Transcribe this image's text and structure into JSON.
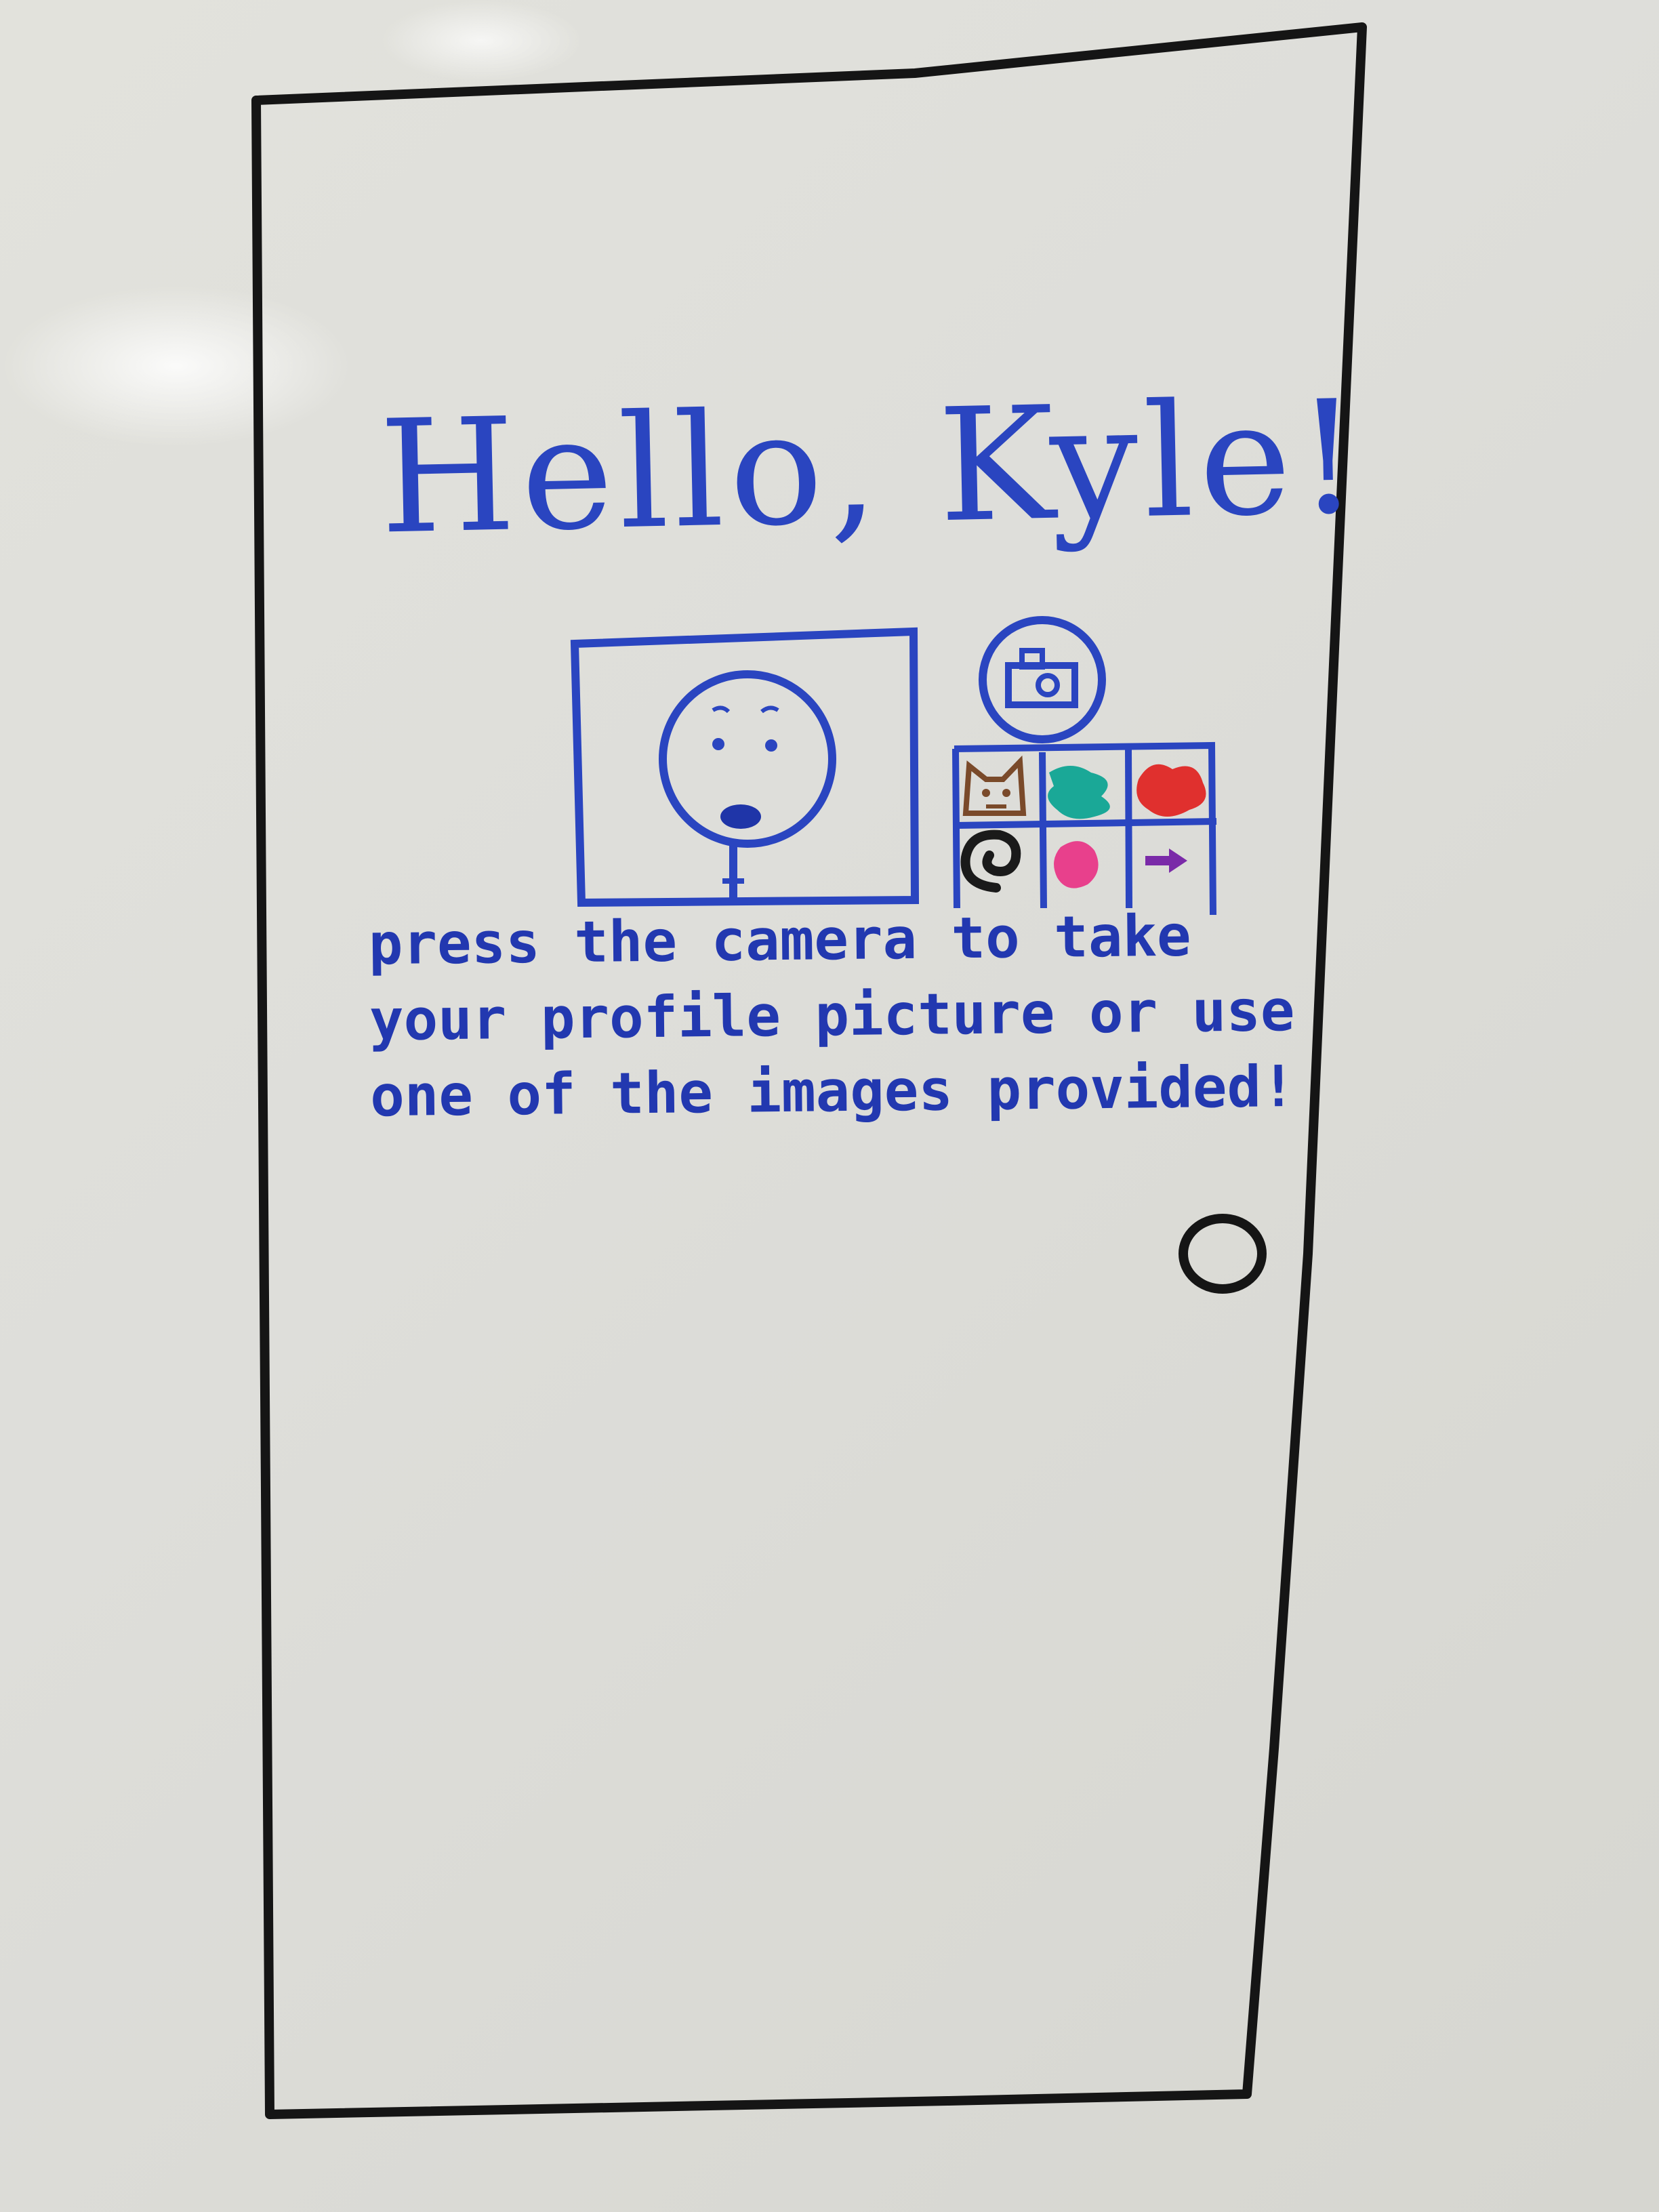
{
  "screen": {
    "greeting": "Hello, Kyle!",
    "instructions": "press the camera to take\nyour profile picture or use\none of the images provided!"
  },
  "profile_preview": {
    "icon": "person-sad-face-icon"
  },
  "camera_button": {
    "icon": "camera-icon"
  },
  "avatar_options": [
    {
      "icon": "cat-icon",
      "color": "#7a4a2a"
    },
    {
      "icon": "green-scribble-icon",
      "color": "#1aa897"
    },
    {
      "icon": "red-flower-icon",
      "color": "#e0302e"
    },
    {
      "icon": "swirl-icon",
      "color": "#1a1a1a"
    },
    {
      "icon": "pink-blob-icon",
      "color": "#e8408c"
    },
    {
      "icon": "arrow-right-icon",
      "color": "#7a2aa8"
    }
  ],
  "colors": {
    "ink_blue": "#2a45c0",
    "ink_black": "#151515"
  }
}
